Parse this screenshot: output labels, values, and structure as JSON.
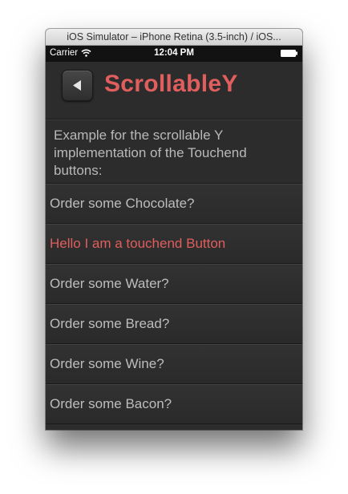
{
  "window": {
    "title": "iOS Simulator – iPhone Retina (3.5-inch) / iOS..."
  },
  "statusbar": {
    "carrier": "Carrier",
    "time": "12:04 PM"
  },
  "header": {
    "title": "ScrollableY",
    "back_icon": "back-arrow-icon"
  },
  "intro": {
    "text": "Example for the scrollable Y implementation of the Touchend buttons:"
  },
  "items": [
    {
      "label": "Order some Chocolate?"
    },
    {
      "label": "Hello I am a touchend Button",
      "active": true
    },
    {
      "label": "Order some Water?"
    },
    {
      "label": "Order some Bread?"
    },
    {
      "label": "Order some Wine?"
    },
    {
      "label": "Order some Bacon?"
    }
  ],
  "colors": {
    "accent": "#e05e5e",
    "text": "#bdbdbd",
    "background": "#2c2c2c"
  }
}
